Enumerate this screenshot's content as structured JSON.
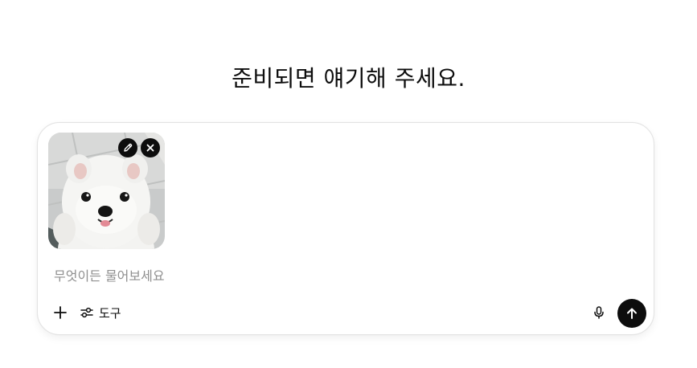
{
  "headline": "준비되면 얘기해 주세요.",
  "composer": {
    "attachment": {
      "image_subject": "white fluffy puppy",
      "edit_icon": "pencil-icon",
      "remove_icon": "close-icon"
    },
    "input": {
      "placeholder": "무엇이든 물어보세요",
      "value": ""
    },
    "toolbar": {
      "add_icon": "plus-icon",
      "tools_icon": "sliders-icon",
      "tools_label": "도구",
      "mic_icon": "microphone-icon",
      "send_icon": "arrow-up-icon"
    }
  },
  "colors": {
    "text": "#0d0d0d",
    "placeholder": "#8f8f8f",
    "border": "#e3e3e3",
    "send_button": "#0d0d0d"
  }
}
